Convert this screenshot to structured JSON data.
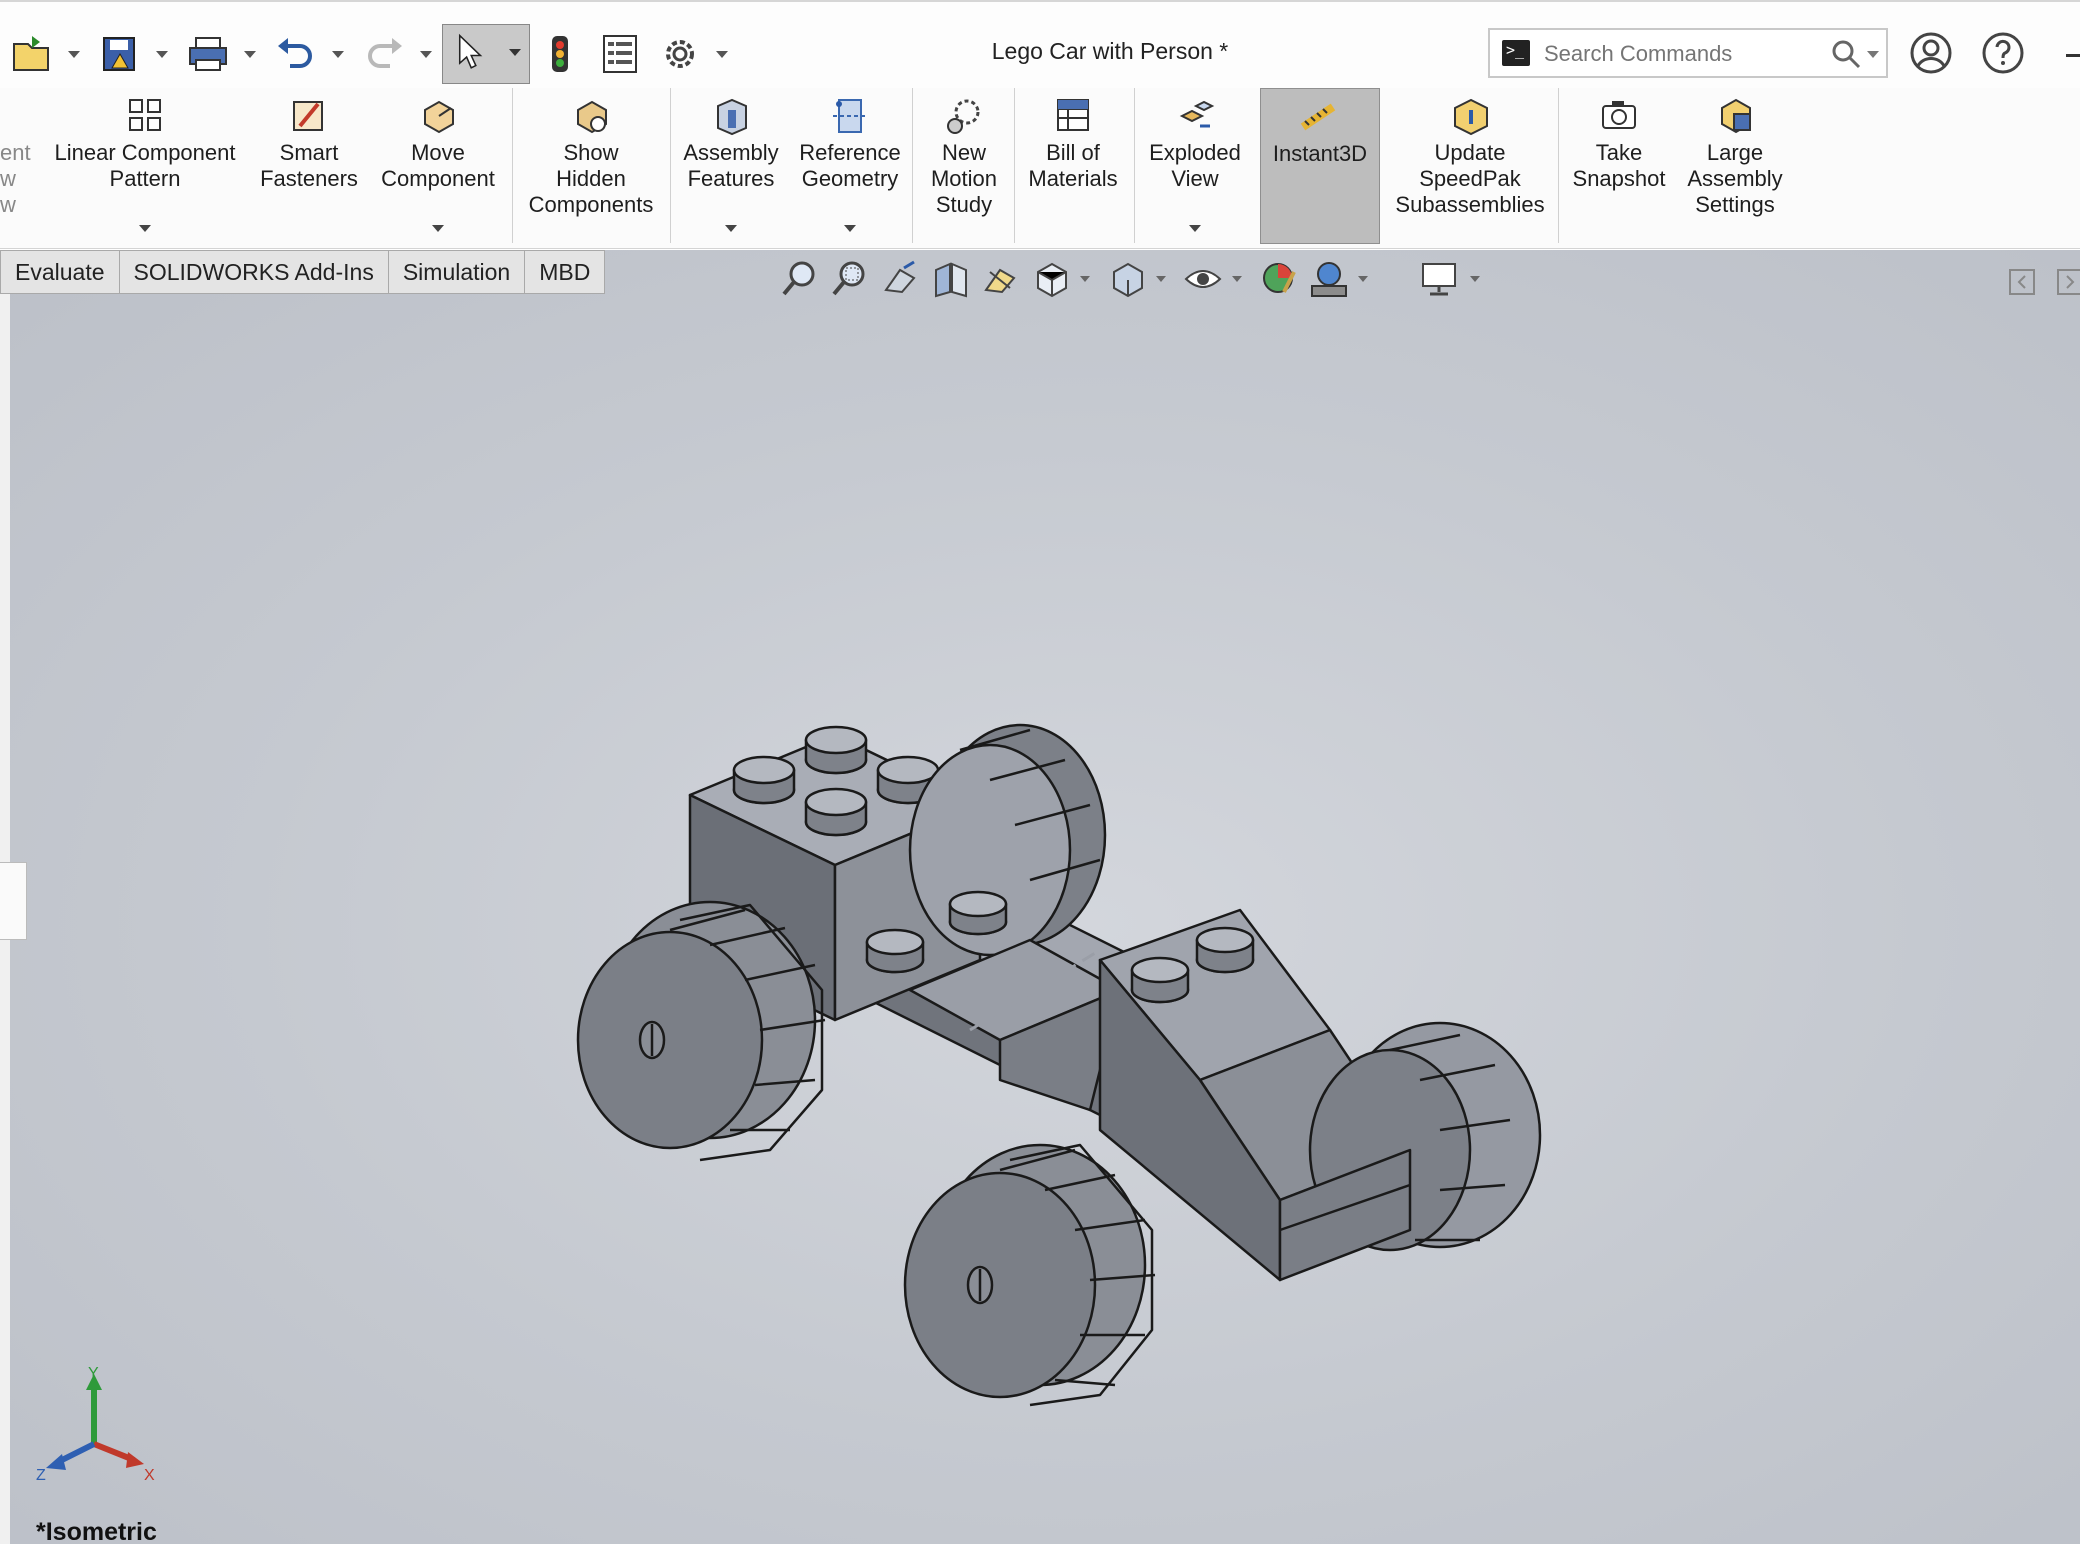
{
  "window": {
    "document_title": "Lego Car with Person *"
  },
  "quick_access": {
    "items": [
      "open-icon",
      "save-icon",
      "print-icon",
      "undo-icon",
      "redo-icon",
      "select-icon",
      "rebuild-icon",
      "file-properties-icon",
      "options-icon"
    ]
  },
  "search": {
    "placeholder": "Search Commands"
  },
  "ribbon": {
    "partial_label": "ent\nw\nw",
    "buttons": [
      {
        "id": "linear-component-pattern",
        "label": "Linear Component\nPattern"
      },
      {
        "id": "smart-fasteners",
        "label": "Smart\nFasteners"
      },
      {
        "id": "move-component",
        "label": "Move\nComponent"
      },
      {
        "id": "show-hidden-components",
        "label": "Show\nHidden\nComponents"
      },
      {
        "id": "assembly-features",
        "label": "Assembly\nFeatures"
      },
      {
        "id": "reference-geometry",
        "label": "Reference\nGeometry"
      },
      {
        "id": "new-motion-study",
        "label": "New\nMotion\nStudy"
      },
      {
        "id": "bill-of-materials",
        "label": "Bill of\nMaterials"
      },
      {
        "id": "exploded-view",
        "label": "Exploded\nView"
      },
      {
        "id": "instant3d",
        "label": "Instant3D"
      },
      {
        "id": "update-speedpak",
        "label": "Update\nSpeedPak\nSubassemblies"
      },
      {
        "id": "take-snapshot",
        "label": "Take\nSnapshot"
      },
      {
        "id": "large-assembly-settings",
        "label": "Large\nAssembly\nSettings"
      }
    ]
  },
  "tabs": [
    "Evaluate",
    "SOLIDWORKS Add-Ins",
    "Simulation",
    "MBD"
  ],
  "viewport": {
    "view_name": "*Isometric",
    "triad": {
      "x": "X",
      "y": "Y",
      "z": "Z"
    },
    "colors": {
      "background": "#c5c9d0",
      "model": "#9ea2ab",
      "edge": "#1a1a1a"
    }
  }
}
